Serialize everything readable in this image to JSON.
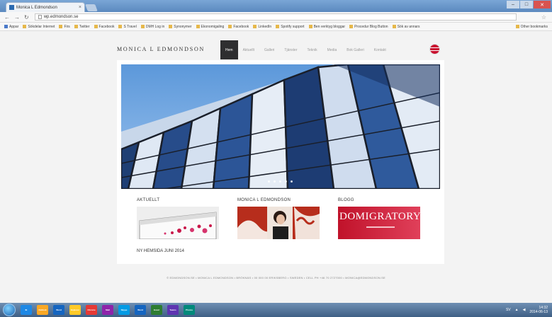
{
  "browser": {
    "tab_title": "Monica L Edmondson",
    "url": "wp.edmondson.se",
    "bookmarks": [
      "Appar",
      "Sökdelar Internet",
      "Firs",
      "Twitter",
      "Facebook",
      "S Travel",
      "DMH Log in",
      "Synonymer",
      "Ekonomigaling",
      "Facebook",
      "LinkedIn",
      "Spotify support",
      "Ben verktyg bloggar",
      "Procedur Blog Button",
      "Sök av annars"
    ],
    "other_bookmarks": "Other bookmarks",
    "close_icon": "×"
  },
  "site": {
    "logo": "MONICA L EDMONDSON",
    "nav": [
      "Hem",
      "Aktuellt",
      "Galleri",
      "Tjänster",
      "Teknik",
      "Media",
      "Bok Galleri",
      "Kontakt"
    ],
    "active_nav": "Hem",
    "sections": {
      "aktuellt": "AKTUELLT",
      "monica": "MONICA L EDMONDSON",
      "blogg": "BLOGG"
    },
    "blog_image_text": "DOMIGRATORY",
    "news_caption": "NY HEMSIDA JUNI 2014",
    "footer": "© EDMONDSON.SE • MONICA L EDMONDSON • BRÖKNÄS • 00 000 00 ERIKSBERG • SWEDEN • CELL PH +46 70 2727000 • MONICA@EDMONDSON.SE"
  },
  "taskbar": {
    "apps": [
      "IE",
      "Outlook",
      "Word",
      "Explorer",
      "Chrome",
      "Mail",
      "Skype",
      "Word",
      "Excel",
      "Teams",
      "Photos"
    ],
    "time": "14:32",
    "date": "2014-06-13",
    "lang": "SV"
  },
  "colors": {
    "nav_active": "#2e2e30",
    "card": "#ffffff",
    "page_bg": "#f3f3f3"
  }
}
